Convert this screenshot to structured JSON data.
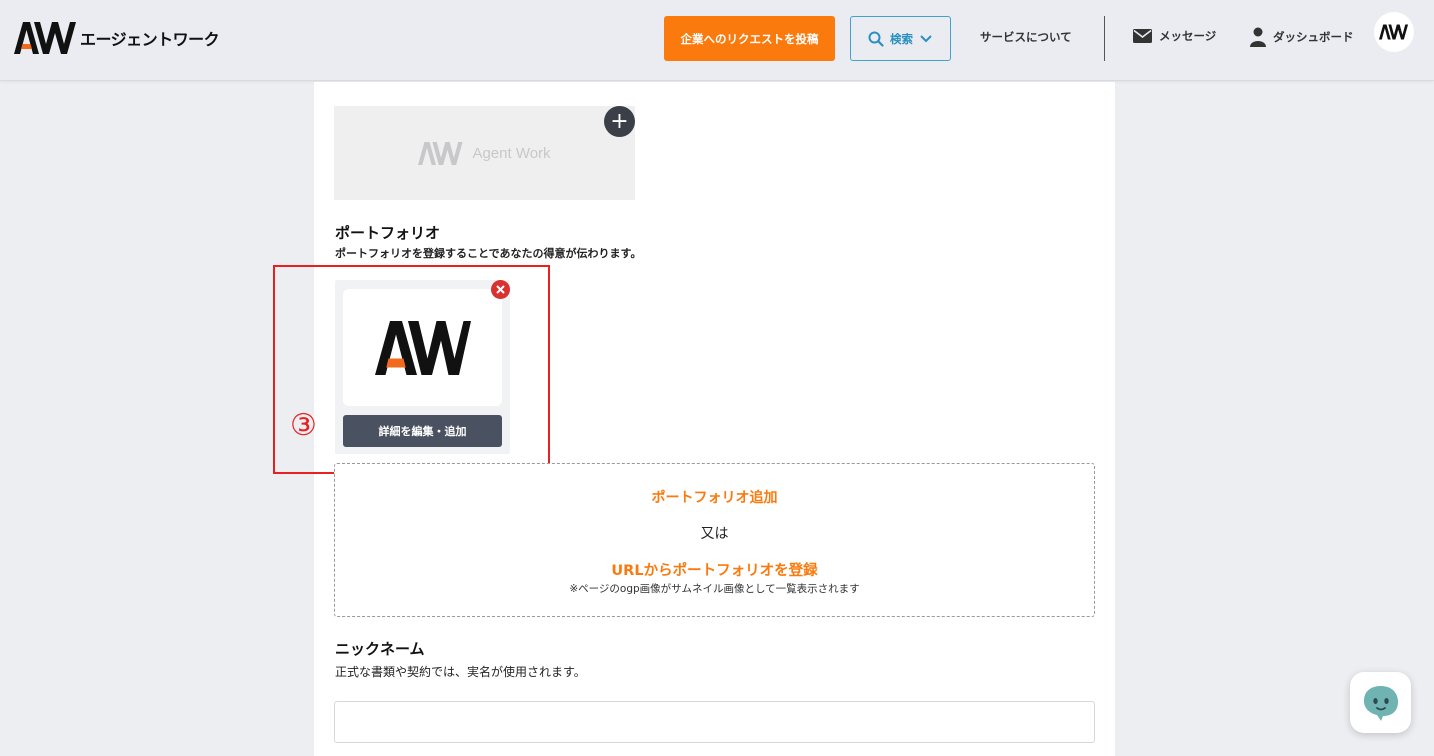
{
  "header": {
    "brand_mark": "AW",
    "brand_name": "エージェントワーク",
    "request_button": "企業へのリクエストを投稿",
    "search_button": "検索",
    "about_link": "サービスについて",
    "messages_link": "メッセージ",
    "dashboard_link": "ダッシュボード",
    "avatar_label": "AW"
  },
  "cover": {
    "placeholder_text": "Agent Work"
  },
  "portfolio": {
    "title": "ポートフォリオ",
    "description": "ポートフォリオを登録することであなたの得意が伝わります。",
    "items": [
      {
        "thumbnail_label": "AW",
        "edit_button": "詳細を編集・追加"
      }
    ],
    "add_link": "ポートフォリオ追加",
    "or_text": "又は",
    "url_link": "URLからポートフォリオを登録",
    "url_note": "※ページのogp画像がサムネイル画像として一覧表示されます"
  },
  "annotation": {
    "step_marker": "③"
  },
  "nickname": {
    "title": "ニックネーム",
    "description": "正式な書類や契約では、実名が使用されます。",
    "value": "",
    "placeholder": ""
  },
  "icons": {
    "search": "search-icon",
    "chevron": "chevron-down-icon",
    "mail": "mail-icon",
    "user": "user-icon",
    "plus": "plus-icon",
    "remove": "close-icon",
    "chat": "chat-bot-icon"
  },
  "colors": {
    "accent_orange": "#fb7a0d",
    "search_blue": "#3fa3cf",
    "annotation_red": "#e8201f",
    "dark_button": "#4a5160"
  }
}
